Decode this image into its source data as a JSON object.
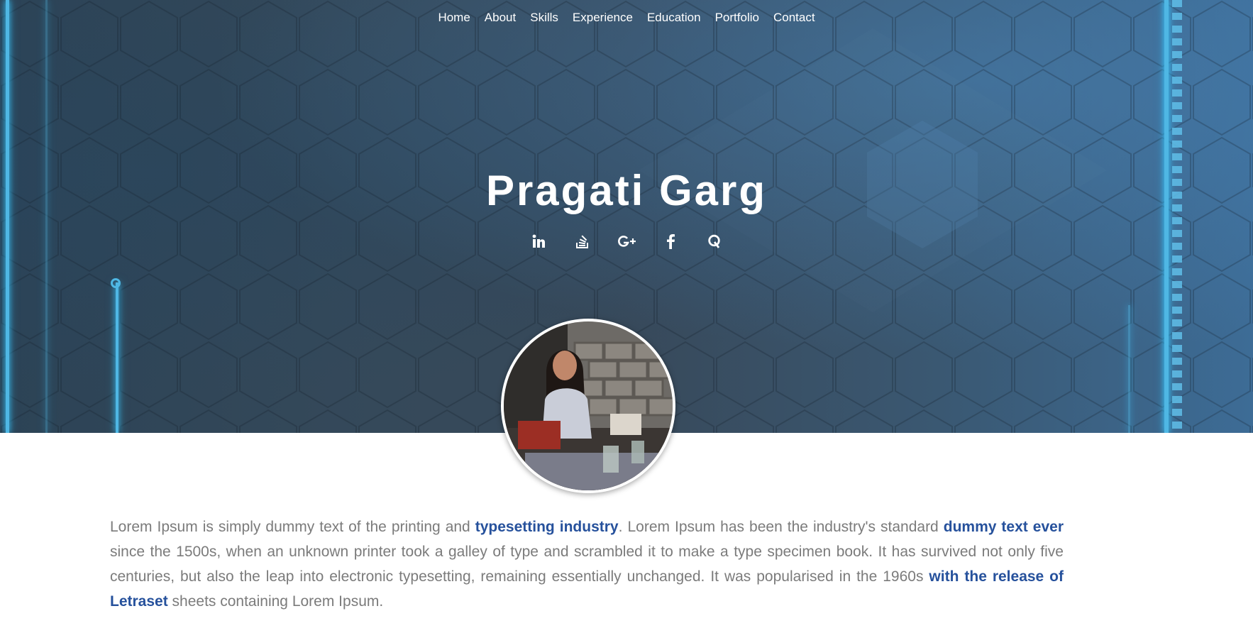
{
  "nav": {
    "items": [
      "Home",
      "About",
      "Skills",
      "Experience",
      "Education",
      "Portfolio",
      "Contact"
    ]
  },
  "hero": {
    "name": "Pragati Garg"
  },
  "social": {
    "icons": [
      "linkedin-icon",
      "stackoverflow-icon",
      "google-plus-icon",
      "facebook-icon",
      "quora-icon"
    ]
  },
  "about": {
    "t1": "Lorem Ipsum is simply dummy text of the printing and ",
    "h1": "typesetting industry",
    "t2": ". Lorem Ipsum has been the industry's standard ",
    "h2": "dummy text ever",
    "t3": " since the 1500s, when an unknown printer took a galley of type and scrambled it to make a type specimen book. It has survived not only five centuries, but also the leap into electronic typesetting, remaining essentially unchanged. It was popularised in the 1960s ",
    "h3": "with the release of Letraset",
    "t4": " sheets containing Lorem Ipsum."
  },
  "colors": {
    "accent_link": "#26519c",
    "body_text": "#7b7b7b",
    "hero_glow": "#4fb7e4"
  }
}
